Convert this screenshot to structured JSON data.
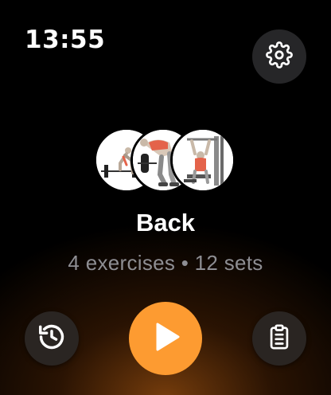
{
  "status_bar": {
    "time": "13:55"
  },
  "workout": {
    "title": "Back",
    "summary": "4 exercises • 12 sets",
    "exercise_thumbnails": [
      "deadlift-icon",
      "barbell-row-icon",
      "lat-pulldown-icon"
    ]
  },
  "controls": {
    "settings_icon": "gear-icon",
    "history_icon": "history-icon",
    "play_icon": "play-icon",
    "list_icon": "clipboard-list-icon"
  },
  "colors": {
    "accent": "#fd9b31",
    "button_bg": "#2c2c2e",
    "secondary_text": "#8e8e93",
    "muscle_highlight": "#e4634a"
  }
}
